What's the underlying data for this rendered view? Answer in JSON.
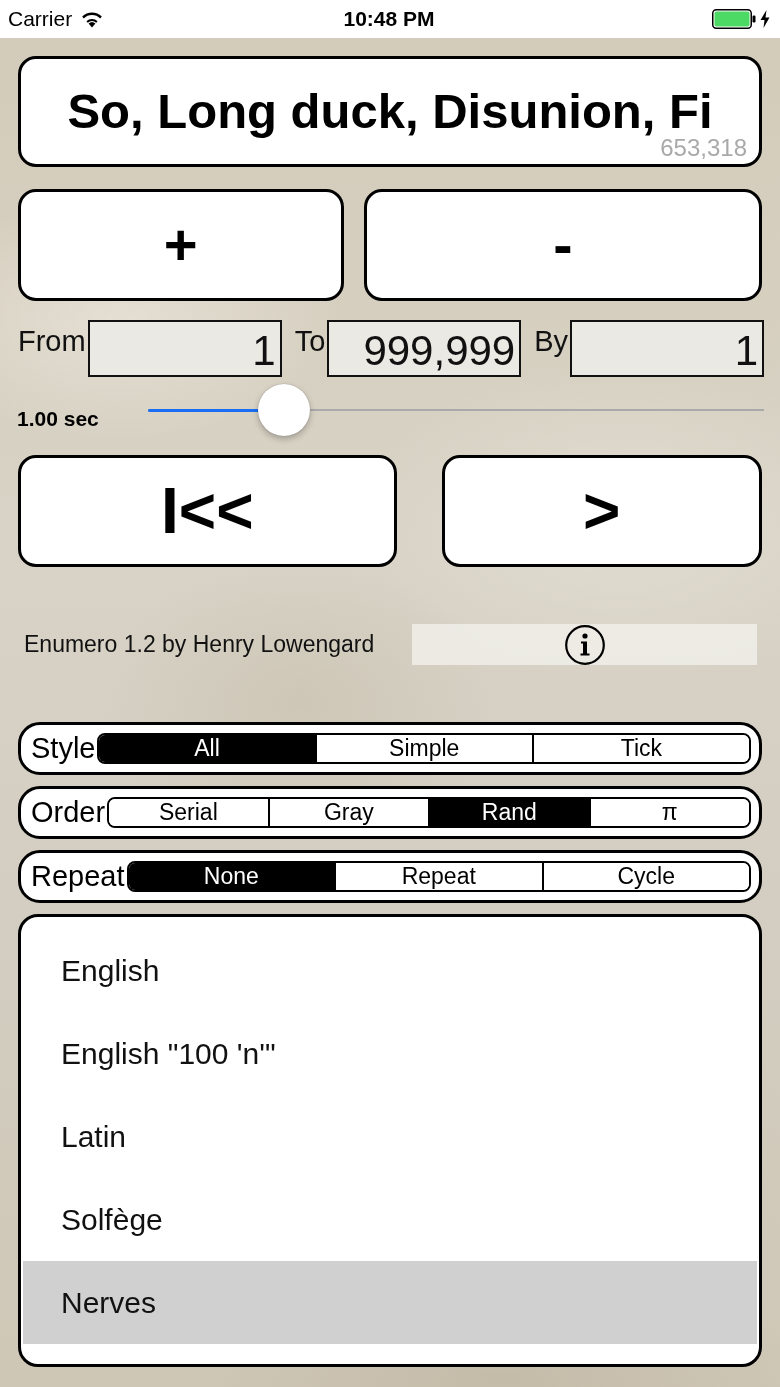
{
  "status_bar": {
    "carrier": "Carrier",
    "time": "10:48 PM"
  },
  "display": {
    "phrase": "So, Long duck, Disunion, Fi",
    "count": "653,318"
  },
  "step_buttons": [
    {
      "label": "+"
    },
    {
      "label": "-"
    }
  ],
  "range_fields": [
    {
      "label": "From",
      "value": "1"
    },
    {
      "label": "To",
      "value": "999,999"
    },
    {
      "label": "By",
      "value": "1"
    }
  ],
  "speed": {
    "reading": "1.00 sec",
    "level": 0.22
  },
  "transport_buttons": [
    {
      "label": "I<<"
    },
    {
      "label": ">"
    }
  ],
  "credit": "Enumero 1.2 by Henry Lowengard",
  "option_rows": [
    {
      "label": "Style",
      "options": [
        {
          "label": "All",
          "selected": true
        },
        {
          "label": "Simple",
          "selected": false
        },
        {
          "label": "Tick",
          "selected": false
        }
      ]
    },
    {
      "label": "Order",
      "options": [
        {
          "label": "Serial",
          "selected": false
        },
        {
          "label": "Gray",
          "selected": false
        },
        {
          "label": "Rand",
          "selected": true
        },
        {
          "label": "π",
          "selected": false
        }
      ]
    },
    {
      "label": "Repeat",
      "options": [
        {
          "label": "None",
          "selected": true
        },
        {
          "label": "Repeat",
          "selected": false
        },
        {
          "label": "Cycle",
          "selected": false
        }
      ]
    }
  ],
  "language_list": [
    {
      "label": "English",
      "selected": false
    },
    {
      "label": "English \"100 'n'\"",
      "selected": false
    },
    {
      "label": "Latin",
      "selected": false
    },
    {
      "label": "Solfège",
      "selected": false
    },
    {
      "label": "Nerves",
      "selected": true
    }
  ]
}
